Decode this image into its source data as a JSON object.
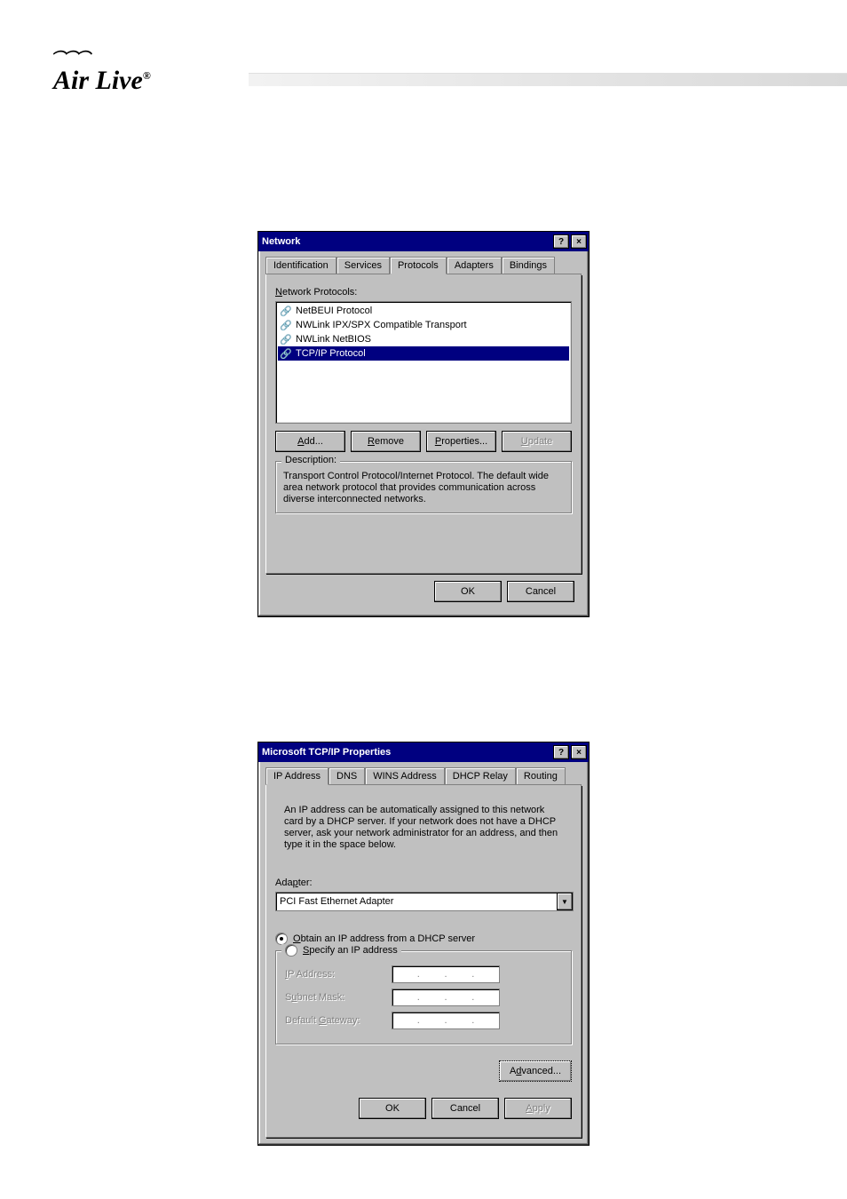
{
  "brand": {
    "name": "Air Live",
    "trademark": "®"
  },
  "dialog1": {
    "title": "Network",
    "titlebar_help": "?",
    "titlebar_close": "×",
    "tabs": [
      "Identification",
      "Services",
      "Protocols",
      "Adapters",
      "Bindings"
    ],
    "active_tab": 2,
    "section_label": "Network Protocols:",
    "protocols": [
      "NetBEUI Protocol",
      "NWLink IPX/SPX Compatible Transport",
      "NWLink NetBIOS",
      "TCP/IP Protocol"
    ],
    "selected_index": 3,
    "buttons": {
      "add": "Add...",
      "remove": "Remove",
      "properties": "Properties...",
      "update": "Update"
    },
    "description_label": "Description:",
    "description": "Transport Control Protocol/Internet Protocol. The default wide area network protocol that provides communication across diverse interconnected networks.",
    "ok": "OK",
    "cancel": "Cancel"
  },
  "dialog2": {
    "title": "Microsoft TCP/IP Properties",
    "titlebar_help": "?",
    "titlebar_close": "×",
    "tabs": [
      "IP Address",
      "DNS",
      "WINS Address",
      "DHCP Relay",
      "Routing"
    ],
    "active_tab": 0,
    "info": "An IP address can be automatically assigned to this network card by a DHCP server. If your network does not have a DHCP server, ask your network administrator for an address, and then type it in the space below.",
    "adapter_label": "Adapter:",
    "adapter_value": "PCI Fast Ethernet Adapter",
    "radio_obtain": "Obtain an IP address from a DHCP server",
    "radio_specify": "Specify an IP address",
    "fields": {
      "ip": "IP Address:",
      "subnet": "Subnet Mask:",
      "gateway": "Default Gateway:"
    },
    "advanced": "Advanced...",
    "ok": "OK",
    "cancel": "Cancel",
    "apply": "Apply"
  }
}
